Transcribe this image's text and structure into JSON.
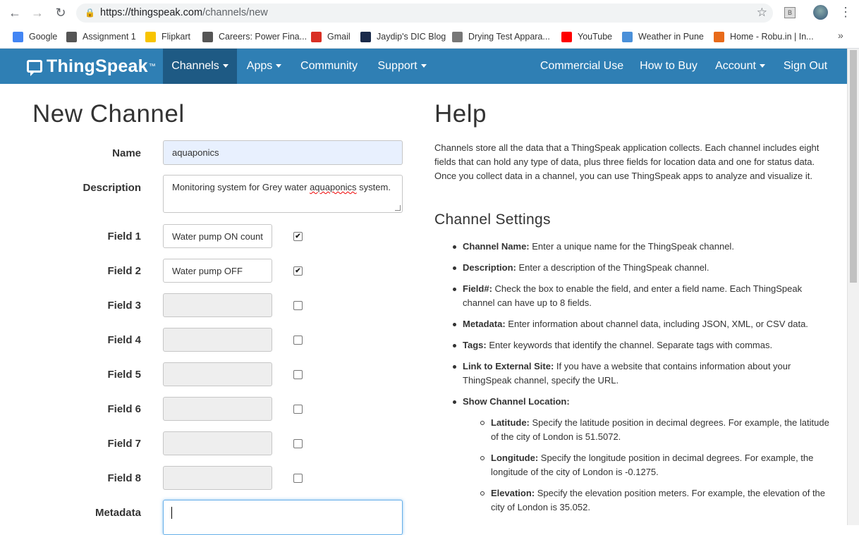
{
  "browser": {
    "url_host": "https://thingspeak.com",
    "url_path": "/channels/new",
    "bookmarks": [
      {
        "label": "Google",
        "icon": "google-icon",
        "color": "#4285f4"
      },
      {
        "label": "Assignment 1",
        "icon": "globe-icon",
        "color": "#555555"
      },
      {
        "label": "Flipkart",
        "icon": "flipkart-icon",
        "color": "#f8c400"
      },
      {
        "label": "Careers: Power Fina...",
        "icon": "globe-icon",
        "color": "#555555"
      },
      {
        "label": "Gmail",
        "icon": "gmail-icon",
        "color": "#d93025"
      },
      {
        "label": "Jaydip's DIC Blog",
        "icon": "blog-icon",
        "color": "#1a2a4a"
      },
      {
        "label": "Drying Test Appara...",
        "icon": "image-icon",
        "color": "#777777"
      },
      {
        "label": "YouTube",
        "icon": "youtube-icon",
        "color": "#ff0000"
      },
      {
        "label": "Weather in Pune",
        "icon": "weather-icon",
        "color": "#4a90d9"
      },
      {
        "label": "Home - Robu.in | In...",
        "icon": "robu-icon",
        "color": "#e86a1a"
      }
    ],
    "more": "»"
  },
  "nav": {
    "brand": "ThingSpeak",
    "tm": "™",
    "items": [
      {
        "label": "Channels",
        "dropdown": true,
        "active": true
      },
      {
        "label": "Apps",
        "dropdown": true
      },
      {
        "label": "Community",
        "dropdown": false
      },
      {
        "label": "Support",
        "dropdown": true
      }
    ],
    "right_items": [
      {
        "label": "Commercial Use",
        "dropdown": false
      },
      {
        "label": "How to Buy",
        "dropdown": false
      },
      {
        "label": "Account",
        "dropdown": true
      },
      {
        "label": "Sign Out",
        "dropdown": false
      }
    ]
  },
  "form": {
    "title": "New Channel",
    "name_label": "Name",
    "name_value": "aquaponics",
    "description_label": "Description",
    "description_value_pre": "Monitoring system for Grey water ",
    "description_value_misspelled": "aquaponics",
    "description_value_post": " system.",
    "fields": [
      {
        "label": "Field 1",
        "value": "Water pump ON  count",
        "checked": true
      },
      {
        "label": "Field 2",
        "value": "Water pump OFF",
        "checked": true
      },
      {
        "label": "Field 3",
        "value": "",
        "checked": false
      },
      {
        "label": "Field 4",
        "value": "",
        "checked": false
      },
      {
        "label": "Field 5",
        "value": "",
        "checked": false
      },
      {
        "label": "Field 6",
        "value": "",
        "checked": false
      },
      {
        "label": "Field 7",
        "value": "",
        "checked": false
      },
      {
        "label": "Field 8",
        "value": "",
        "checked": false
      }
    ],
    "metadata_label": "Metadata",
    "metadata_value": ""
  },
  "help": {
    "title": "Help",
    "intro": "Channels store all the data that a ThingSpeak application collects. Each channel includes eight fields that can hold any type of data, plus three fields for location data and one for status data. Once you collect data in a channel, you can use ThingSpeak apps to analyze and visualize it.",
    "settings_title": "Channel Settings",
    "items": [
      {
        "term": "Channel Name:",
        "text": " Enter a unique name for the ThingSpeak channel."
      },
      {
        "term": "Description:",
        "text": " Enter a description of the ThingSpeak channel."
      },
      {
        "term": "Field#:",
        "text": " Check the box to enable the field, and enter a field name. Each ThingSpeak channel can have up to 8 fields."
      },
      {
        "term": "Metadata:",
        "text": " Enter information about channel data, including JSON, XML, or CSV data."
      },
      {
        "term": "Tags:",
        "text": " Enter keywords that identify the channel. Separate tags with commas."
      },
      {
        "term": "Link to External Site:",
        "text": " If you have a website that contains information about your ThingSpeak channel, specify the URL."
      },
      {
        "term": "Show Channel Location:",
        "text": ""
      }
    ],
    "sub_items": [
      {
        "term": "Latitude:",
        "text": " Specify the latitude position in decimal degrees. For example, the latitude of the city of London is 51.5072."
      },
      {
        "term": "Longitude:",
        "text": " Specify the longitude position in decimal degrees. For example, the longitude of the city of London is -0.1275."
      },
      {
        "term": "Elevation:",
        "text": " Specify the elevation position meters. For example, the elevation of the city of London is 35.052."
      }
    ]
  }
}
